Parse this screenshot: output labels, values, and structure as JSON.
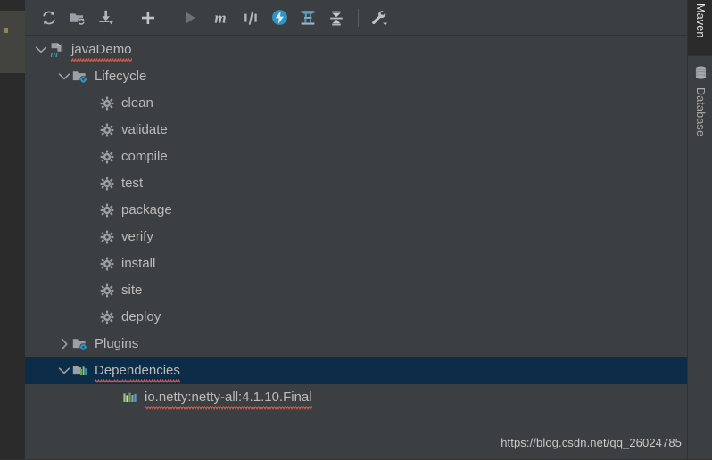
{
  "toolbar": {
    "buttons": [
      {
        "name": "reimport-icon",
        "title": "Reimport All Maven Projects"
      },
      {
        "name": "generate-sources-folder-icon",
        "title": "Generate Sources and Update Folders"
      },
      {
        "name": "download-sources-icon",
        "title": "Download Sources and/or Documentation"
      },
      {
        "name": "add-maven-project-icon",
        "title": "Add Maven Project"
      },
      {
        "name": "run-icon",
        "title": "Run Maven Build"
      },
      {
        "name": "maven-m-icon",
        "title": "Execute Maven Goal"
      },
      {
        "name": "toggle-skip-tests-icon",
        "title": "Toggle Skip Tests Mode"
      },
      {
        "name": "toggle-offline-icon",
        "title": "Toggle Offline Mode"
      },
      {
        "name": "expand-all-icon",
        "title": "Expand All"
      },
      {
        "name": "collapse-all-icon",
        "title": "Collapse All"
      },
      {
        "name": "maven-settings-icon",
        "title": "Maven Settings"
      }
    ]
  },
  "tree": {
    "nodes": [
      {
        "label": "javaDemo",
        "icon": "maven-module-icon",
        "arrow": "chevron-down",
        "indent": 0,
        "selected": false,
        "misspelled": true
      },
      {
        "label": "Lifecycle",
        "icon": "lifecycle-folder-icon",
        "arrow": "chevron-down",
        "indent": 1,
        "selected": false,
        "misspelled": false
      },
      {
        "label": "clean",
        "icon": "goal-gear-icon",
        "arrow": "none",
        "indent": 2,
        "selected": false,
        "misspelled": false
      },
      {
        "label": "validate",
        "icon": "goal-gear-icon",
        "arrow": "none",
        "indent": 2,
        "selected": false,
        "misspelled": false
      },
      {
        "label": "compile",
        "icon": "goal-gear-icon",
        "arrow": "none",
        "indent": 2,
        "selected": false,
        "misspelled": false
      },
      {
        "label": "test",
        "icon": "goal-gear-icon",
        "arrow": "none",
        "indent": 2,
        "selected": false,
        "misspelled": false
      },
      {
        "label": "package",
        "icon": "goal-gear-icon",
        "arrow": "none",
        "indent": 2,
        "selected": false,
        "misspelled": false
      },
      {
        "label": "verify",
        "icon": "goal-gear-icon",
        "arrow": "none",
        "indent": 2,
        "selected": false,
        "misspelled": false
      },
      {
        "label": "install",
        "icon": "goal-gear-icon",
        "arrow": "none",
        "indent": 2,
        "selected": false,
        "misspelled": false
      },
      {
        "label": "site",
        "icon": "goal-gear-icon",
        "arrow": "none",
        "indent": 2,
        "selected": false,
        "misspelled": false
      },
      {
        "label": "deploy",
        "icon": "goal-gear-icon",
        "arrow": "none",
        "indent": 2,
        "selected": false,
        "misspelled": false
      },
      {
        "label": "Plugins",
        "icon": "plugins-folder-icon",
        "arrow": "chevron-right",
        "indent": 1,
        "selected": false,
        "misspelled": false
      },
      {
        "label": "Dependencies",
        "icon": "dependencies-folder-icon",
        "arrow": "chevron-down",
        "indent": 1,
        "selected": true,
        "misspelled": true
      },
      {
        "label": "io.netty:netty-all:4.1.10.Final",
        "icon": "dependency-bars-icon",
        "arrow": "none",
        "indent": 3,
        "selected": false,
        "misspelled": true
      }
    ]
  },
  "right_strip": {
    "tabs": [
      {
        "label": "Maven",
        "icon": "none",
        "active": true
      },
      {
        "label": "Database",
        "icon": "database-icon",
        "active": false
      }
    ]
  },
  "watermark": {
    "text": "https://blog.csdn.net/qq_26024785"
  },
  "colors": {
    "panel_bg": "#3c3f41",
    "editor_bg": "#2b2b2b",
    "selection_bg": "#0d2c47",
    "text": "#bbbbbb",
    "accent_blue": "#359ac6",
    "icon_gray": "#9aa0a6",
    "spellcheck_red": "#e05c4b",
    "dep_green": "#6aa84f"
  }
}
